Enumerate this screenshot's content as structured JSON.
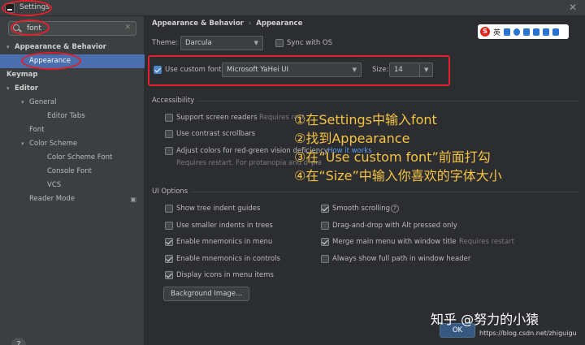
{
  "window": {
    "title": "Settings"
  },
  "sidebar": {
    "search_value": "font",
    "items": [
      {
        "label": "Appearance & Behavior",
        "level": 0,
        "arrow": "▾",
        "bold": true
      },
      {
        "label": "Appearance",
        "level": 1,
        "selected": true
      },
      {
        "label": "Keymap",
        "level": 0,
        "bold": true
      },
      {
        "label": "Editor",
        "level": 0,
        "arrow": "▾",
        "bold": true
      },
      {
        "label": "General",
        "level": 1,
        "arrow": "▾"
      },
      {
        "label": "Editor Tabs",
        "level": 2
      },
      {
        "label": "Font",
        "level": 1
      },
      {
        "label": "Color Scheme",
        "level": 1,
        "arrow": "▾"
      },
      {
        "label": "Color Scheme Font",
        "level": 2
      },
      {
        "label": "Console Font",
        "level": 2
      },
      {
        "label": "VCS",
        "level": 2
      },
      {
        "label": "Reader Mode",
        "level": 1,
        "gear": true
      }
    ],
    "help_label": "?"
  },
  "breadcrumb": {
    "parent": "Appearance & Behavior",
    "current": "Appearance"
  },
  "theme": {
    "label": "Theme:",
    "value": "Darcula",
    "sync_label": "Sync with OS"
  },
  "custom_font": {
    "checkbox_label": "Use custom font:",
    "font_value": "Microsoft YaHei UI",
    "size_label": "Size:",
    "size_value": "14"
  },
  "accessibility": {
    "title": "Accessibility",
    "screen_readers": "Support screen readers",
    "requires_restart": "Requires rest",
    "contrast_scrollbars": "Use contrast scrollbars",
    "adjust_colors": "Adjust colors for red-green vision deficiency",
    "how_it_works": "How it works",
    "restart_note": "Requires restart. For protanopia and d",
    "restart_note_tail": "pia"
  },
  "ui_options": {
    "title": "UI Options",
    "left": [
      {
        "label": "Show tree indent guides",
        "checked": false
      },
      {
        "label": "Use smaller indents in trees",
        "checked": false
      },
      {
        "label": "Enable mnemonics in menu",
        "checked": true
      },
      {
        "label": "Enable mnemonics in controls",
        "checked": true
      },
      {
        "label": "Display icons in menu items",
        "checked": true
      }
    ],
    "right": [
      {
        "label": "Smooth scrolling",
        "checked": true
      },
      {
        "label": "Drag-and-drop with Alt pressed only",
        "checked": false
      },
      {
        "label": "Merge main menu with window title",
        "checked": true
      },
      {
        "label": "Always show full path in window header",
        "checked": false
      }
    ],
    "merge_restart": "Requires restart",
    "background_button": "Background Image..."
  },
  "annotation": {
    "lines": [
      "①在Settings中输入font",
      "②找到Appearance",
      "③在“Use custom font”前面打勾",
      "④在“Size”中输入你喜欢的字体大小"
    ]
  },
  "ime_toolbar": {
    "logo": "S",
    "mode": "英"
  },
  "footer": {
    "ok_label": "OK",
    "watermark": "知乎 @努力的小猿",
    "csdn": "https://blog.csdn.net/zhiguigu"
  },
  "colors": {
    "accent": "#4b6eaf",
    "annotation": "#f6c343",
    "highlight_ring": "#e0202a"
  }
}
